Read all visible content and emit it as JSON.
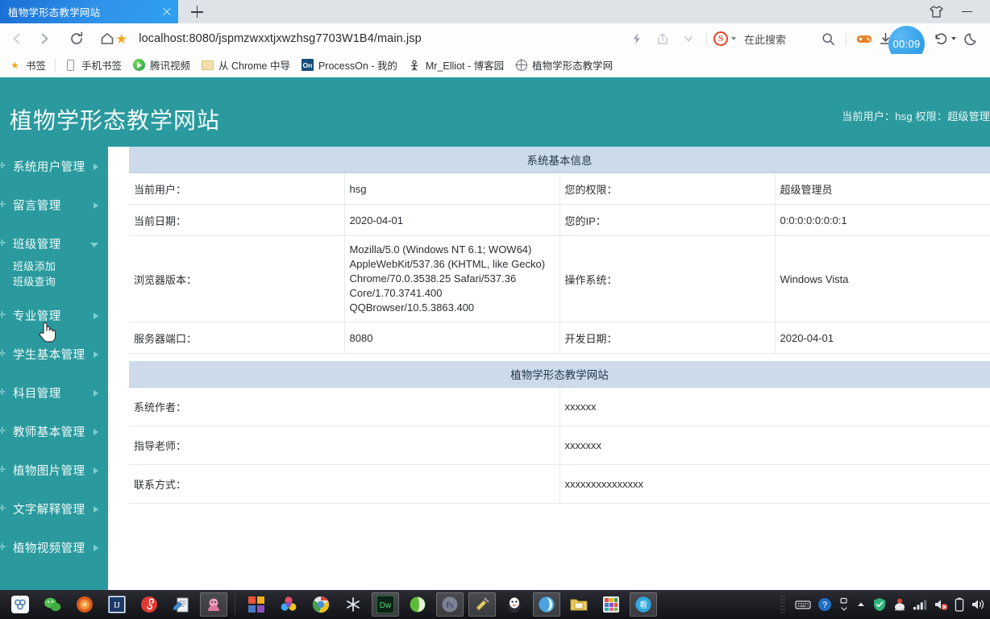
{
  "browser": {
    "tab": {
      "title": "植物学形态教学网站",
      "close_icon": "close-icon"
    },
    "new_tab_label": "+",
    "address": "localhost:8080/jspmzwxxtjxwzhsg7703W1B4/main.jsp",
    "search_engine_label": "S",
    "search_placeholder": "在此搜索",
    "download_timer": "00:09",
    "bookmarks": [
      {
        "label": "书签",
        "icon": "star-icon"
      },
      {
        "label": "手机书签",
        "icon": "phone-icon"
      },
      {
        "label": "腾讯视频",
        "icon": "tencent-video-icon"
      },
      {
        "label": "从 Chrome 中导",
        "icon": "folder-icon"
      },
      {
        "label": "ProcessOn - 我的",
        "icon": "processon-icon"
      },
      {
        "label": "Mr_Elliot - 博客园",
        "icon": "cnblogs-icon"
      },
      {
        "label": "植物学形态教学网",
        "icon": "globe-icon"
      }
    ]
  },
  "site": {
    "title": "植物学形态教学网站",
    "user_info": "当前用户：hsg  权限：超级管理",
    "sidebar": [
      {
        "label": "系统用户管理",
        "expanded": false
      },
      {
        "label": "留言管理",
        "expanded": false
      },
      {
        "label": "班级管理",
        "expanded": true,
        "children": [
          "班级添加",
          "班级查询"
        ]
      },
      {
        "label": "专业管理",
        "expanded": false
      },
      {
        "label": "学生基本管理",
        "expanded": false
      },
      {
        "label": "科目管理",
        "expanded": false
      },
      {
        "label": "教师基本管理",
        "expanded": false
      },
      {
        "label": "植物图片管理",
        "expanded": false
      },
      {
        "label": "文字解释管理",
        "expanded": false
      },
      {
        "label": "植物视频管理",
        "expanded": false
      }
    ]
  },
  "main": {
    "section1_title": "系统基本信息",
    "rows1": [
      {
        "l1": "当前用户：",
        "v1": "hsg",
        "l2": "您的权限：",
        "v2": "超级管理员"
      },
      {
        "l1": "当前日期：",
        "v1": "2020-04-01",
        "l2": "您的IP：",
        "v2": "0:0:0:0:0:0:0:1"
      },
      {
        "l1": "浏览器版本：",
        "v1": "Mozilla/5.0 (Windows NT 6.1; WOW64) AppleWebKit/537.36 (KHTML, like Gecko) Chrome/70.0.3538.25 Safari/537.36 Core/1.70.3741.400 QQBrowser/10.5.3863.400",
        "l2": "操作系统：",
        "v2": "Windows Vista"
      },
      {
        "l1": "服务器端口：",
        "v1": "8080",
        "l2": "开发日期：",
        "v2": "2020-04-01"
      }
    ],
    "section2_title": "植物学形态教学网站",
    "rows2": [
      {
        "l1": "系统作者：",
        "v1": "xxxxxx"
      },
      {
        "l1": "指导老师：",
        "v1": "xxxxxxx"
      },
      {
        "l1": "联系方式：",
        "v1": "xxxxxxxxxxxxxxx"
      }
    ]
  },
  "colors": {
    "theme_teal": "#2b9a9e",
    "table_head_blue": "#ccdaea",
    "tab_blue": "#2f93ea",
    "accent_orange": "#f5a623"
  }
}
